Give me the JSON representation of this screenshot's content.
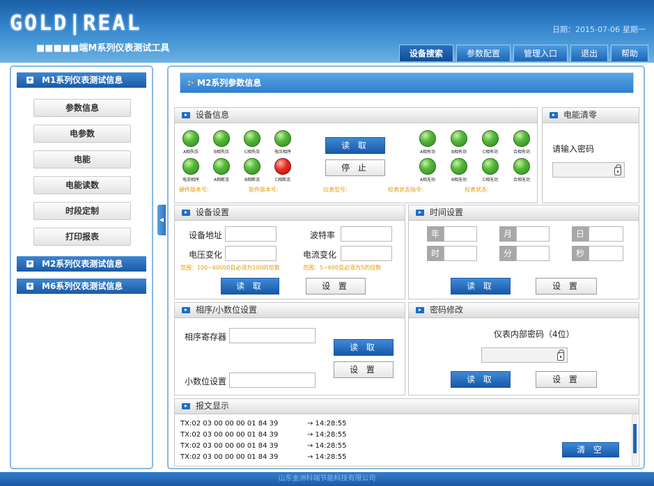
{
  "header": {
    "logo": "GOLD|REAL",
    "subtitle": "■■■■■端M系列仪表测试工具",
    "date_label": "日期：2015-07-06",
    "weekday": "星期一",
    "nav": [
      "设备搜索",
      "参数配置",
      "管理入口",
      "退出",
      "帮助"
    ]
  },
  "sidebar": {
    "m1_title": "M1系列仪表测试信息",
    "m1_items": [
      "参数信息",
      "电参数",
      "电能",
      "电能读数",
      "时段定制",
      "打印报表"
    ],
    "m2_title": "M2系列仪表测试信息",
    "m6_title": "M6系列仪表测试信息"
  },
  "main": {
    "title": "M2系列参数信息",
    "device_info": {
      "title": "设备信息",
      "leds_row1_left": [
        "A相失压",
        "B相失压",
        "C相失压",
        "电压相序"
      ],
      "leds_row2_left": [
        "电流相序",
        "A相断流",
        "B相断流",
        "C相断流"
      ],
      "leds_row1_right": [
        "A相有功",
        "B相有功",
        "C相有功",
        "合相有功"
      ],
      "leds_row2_right": [
        "A相无功",
        "B相无功",
        "C相无功",
        "合相无功"
      ],
      "read_btn": "读 取",
      "stop_btn": "停 止",
      "hw_version": "硬件版本号:",
      "sw_version": "软件版本号:",
      "model": "仪表型号:",
      "calib_cmd": "校表状态指令:",
      "calib_state": "校表状态:"
    },
    "energy_clear": {
      "title": "电能清零",
      "prompt": "请输入密码"
    },
    "device_settings": {
      "title": "设备设置",
      "addr": "设备地址",
      "baud": "波特率",
      "vchange": "电压变化",
      "ichange": "电流变化",
      "vrange": "范围：100~60000且必须为100的倍数",
      "irange": "范围：5~600且必须为5的倍数",
      "read_btn": "读 取",
      "set_btn": "设 置"
    },
    "time_settings": {
      "title": "时间设置",
      "year": "年",
      "month": "月",
      "day": "日",
      "hour": "时",
      "minute": "分",
      "second": "秒",
      "read_btn": "读 取",
      "set_btn": "设 置"
    },
    "phase": {
      "title": "相序/小数位设置",
      "phase_reg": "相序寄存器",
      "decimal": "小数位设置",
      "read_btn": "读 取",
      "set_btn": "设 置"
    },
    "password": {
      "title": "密码修改",
      "label": "仪表内部密码（4位）",
      "read_btn": "读 取",
      "set_btn": "设 置"
    },
    "log": {
      "title": "报文显示",
      "lines": [
        {
          "msg": "TX:02 03 00 00 00 01 84 39",
          "time": "→ 14:28:55"
        },
        {
          "msg": "TX:02 03 00 00 00 01 84 39",
          "time": "→ 14:28:55"
        },
        {
          "msg": "TX:02 03 00 00 00 01 84 39",
          "time": "→ 14:28:55"
        },
        {
          "msg": "TX:02 03 00 00 00 01 84 39",
          "time": "→ 14:28:55"
        }
      ],
      "clear_btn": "清 空"
    }
  },
  "footer": {
    "text": "山东金洲科瑞节能科技有限公司"
  }
}
